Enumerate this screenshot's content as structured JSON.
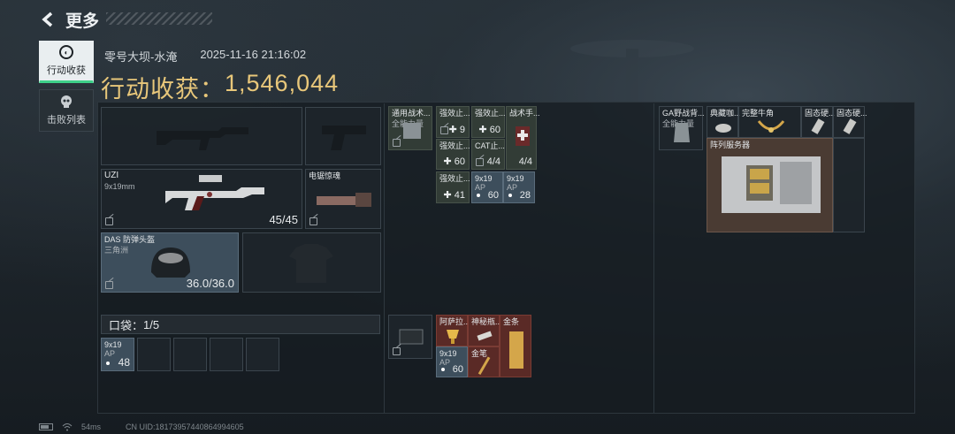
{
  "header": {
    "title": "更多"
  },
  "nav": [
    {
      "label": "行动收获",
      "icon": "loot-icon",
      "active": true
    },
    {
      "label": "击败列表",
      "icon": "skull-icon",
      "active": false
    }
  ],
  "match": {
    "map": "零号大坝-水淹",
    "datetime": "2025-11-16 21:16:02"
  },
  "loot": {
    "label": "行动收获：",
    "value": "1,546,044"
  },
  "equipment": {
    "primary": {
      "name": "UZI",
      "ammo": "9x19mm",
      "count": "45/45"
    },
    "secondary": {
      "name": "电锯惊魂"
    },
    "helmet": {
      "name": "DAS 防弹头盔",
      "sub": "三角洲",
      "durability": "36.0/36.0"
    }
  },
  "pocket": {
    "label": "口袋：",
    "value": "1/5",
    "item": {
      "name": "9x19",
      "sub": "AP",
      "count": "48"
    }
  },
  "backpack": {
    "top_left": {
      "name": "通用战术...",
      "sub": "全能力量"
    },
    "items": [
      {
        "name": "强效止...",
        "count": "9"
      },
      {
        "name": "强效止...",
        "count": "60"
      },
      {
        "name": "战术手...",
        "count": ""
      },
      {
        "name": "强效止...",
        "count": "60"
      },
      {
        "name": "CAT止...",
        "count": "4/4"
      },
      {
        "name": "",
        "count": "4/4"
      },
      {
        "name": "强效止...",
        "count": "41"
      },
      {
        "name": "9x19",
        "sub": "AP",
        "count": "60"
      },
      {
        "name": "9x19",
        "sub": "AP",
        "count": "28"
      }
    ],
    "lower": [
      {
        "name": "阿萨拉...",
        "count": ""
      },
      {
        "name": "神秘瓶...",
        "count": ""
      },
      {
        "name": "金条",
        "count": ""
      },
      {
        "name": "9x19",
        "sub": "AP",
        "count": "60"
      },
      {
        "name": "金笔",
        "count": ""
      }
    ]
  },
  "chest": {
    "vest": {
      "name": "GA野战背...",
      "sub": "全能力量"
    },
    "items": [
      {
        "name": "典藏咖..."
      },
      {
        "name": "完整牛角"
      },
      {
        "name": "固态硬..."
      },
      {
        "name": "固态硬..."
      }
    ],
    "server": {
      "name": "阵列服务器"
    }
  },
  "status": {
    "ping": "54ms",
    "uid": "CN UID:18173957440864994605"
  },
  "colors": {
    "accent": "#e8c77a",
    "active_tab": "#3ed18a",
    "rare_gold": "#5a2a26",
    "blue": "#3d4e5c"
  }
}
